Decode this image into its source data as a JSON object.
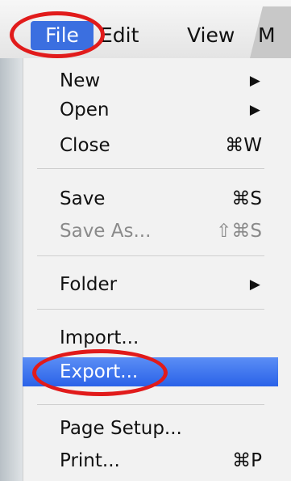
{
  "menubar": {
    "file_label": "File",
    "edit_label": "Edit",
    "view_label": "View",
    "next_label": "M"
  },
  "file_menu": {
    "items": [
      {
        "label": "New",
        "shortcut": "",
        "submenu": true
      },
      {
        "label": "Open",
        "shortcut": "",
        "submenu": true
      },
      {
        "label": "Close",
        "shortcut": "⌘W",
        "submenu": false
      },
      {
        "label": "Save",
        "shortcut": "⌘S",
        "submenu": false
      },
      {
        "label": "Save As...",
        "shortcut": "⇧⌘S",
        "submenu": false,
        "disabled": true
      },
      {
        "label": "Folder",
        "shortcut": "",
        "submenu": true
      },
      {
        "label": "Import...",
        "shortcut": "",
        "submenu": false
      },
      {
        "label": "Export...",
        "shortcut": "",
        "submenu": false,
        "highlighted": true
      },
      {
        "label": "Page Setup...",
        "shortcut": "",
        "submenu": false
      },
      {
        "label": "Print...",
        "shortcut": "⌘P",
        "submenu": false
      }
    ],
    "submenu_arrow": "▶"
  },
  "colors": {
    "highlight": "#3b6fe0",
    "annotation": "#e11b1b"
  },
  "icons": {
    "submenu": "submenu-arrow-icon"
  }
}
